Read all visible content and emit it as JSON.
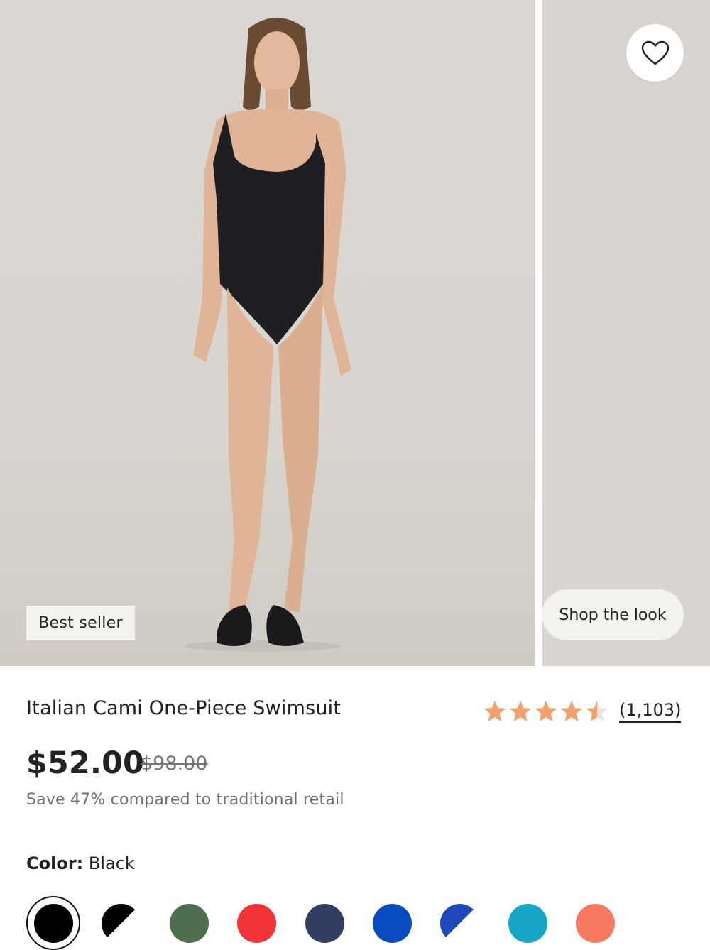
{
  "gallery": {
    "badge": "Best seller",
    "shop_the_look": "Shop the look",
    "favorite_icon": "heart-outline-icon"
  },
  "product": {
    "title": "Italian Cami One-Piece Swimsuit",
    "rating": 4.5,
    "review_count": "(1,103)",
    "price": "$52.00",
    "original_price": "$98.00",
    "savings_text": "Save 47% compared to traditional retail"
  },
  "color": {
    "label": "Color:",
    "selected": "Black",
    "swatches": [
      {
        "name": "black",
        "color": "#000000",
        "selected": true
      },
      {
        "name": "black-white",
        "color": "#000000",
        "split": "#ffffff"
      },
      {
        "name": "green",
        "color": "#4e6e50"
      },
      {
        "name": "red",
        "color": "#f23337"
      },
      {
        "name": "navy",
        "color": "#333e63"
      },
      {
        "name": "cobalt",
        "color": "#0a4cc0"
      },
      {
        "name": "cobalt-white",
        "color": "#1f47b8",
        "split": "#ffffff"
      },
      {
        "name": "teal",
        "color": "#14a5c7"
      },
      {
        "name": "coral",
        "color": "#f77a60"
      }
    ]
  },
  "colors": {
    "star": "#f3a06c",
    "star_empty": "#e6e3de"
  }
}
